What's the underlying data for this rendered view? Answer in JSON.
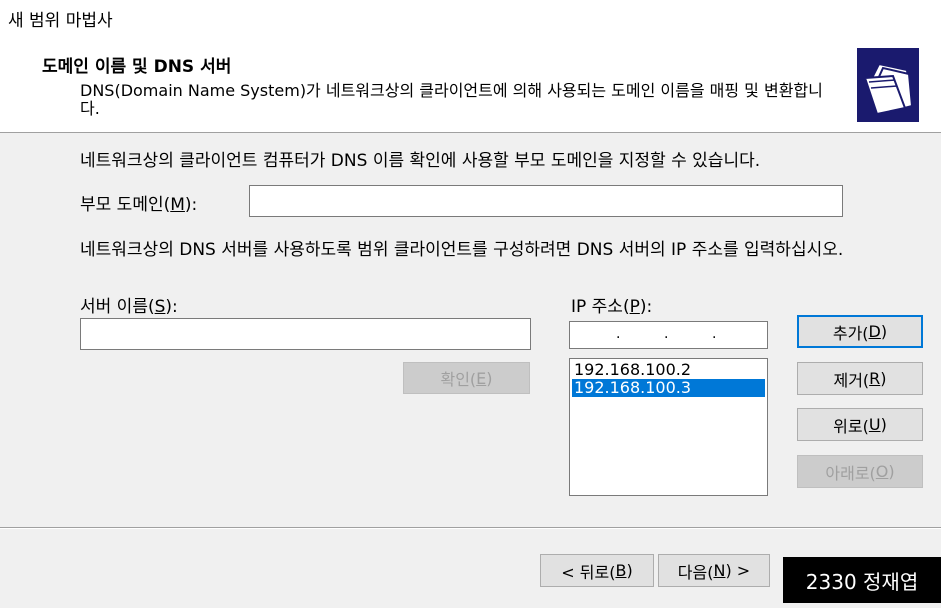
{
  "window": {
    "title": "새 범위 마법사"
  },
  "header": {
    "title": "도메인 이름 및 DNS 서버",
    "description": "DNS(Domain Name System)가 네트워크상의 클라이언트에 의해 사용되는 도메인 이름을 매핑 및 변환합니다.",
    "icon": "folders-icon"
  },
  "body": {
    "intro": "네트워크상의 클라이언트 컴퓨터가 DNS 이름 확인에 사용할 부모 도메인을 지정할 수 있습니다.",
    "parent_domain_label": "부모 도메인(",
    "parent_domain_key": "M",
    "parent_domain_suffix": "):",
    "parent_domain_value": "",
    "dns_instruction": "네트워크상의 DNS 서버를 사용하도록 범위 클라이언트를 구성하려면 DNS 서버의 IP 주소를 입력하십시오.",
    "server_name_label": "서버 이름(",
    "server_name_key": "S",
    "server_name_suffix": "):",
    "server_name_value": "",
    "ip_label": "IP 주소(",
    "ip_key": "P",
    "ip_suffix": "):",
    "resolve_button": {
      "label": "확인(",
      "key": "E",
      "suffix": ")"
    },
    "ip_list": [
      {
        "value": "192.168.100.2",
        "selected": false
      },
      {
        "value": "192.168.100.3",
        "selected": true
      }
    ],
    "buttons": {
      "add": {
        "label": "추가(",
        "key": "D",
        "suffix": ")"
      },
      "remove": {
        "label": "제거(",
        "key": "R",
        "suffix": ")"
      },
      "up": {
        "label": "위로(",
        "key": "U",
        "suffix": ")"
      },
      "down": {
        "label": "아래로(",
        "key": "O",
        "suffix": ")"
      }
    }
  },
  "footer": {
    "back": {
      "label": "< 뒤로(",
      "key": "B",
      "suffix": ")"
    },
    "next": {
      "label": "다음(",
      "key": "N",
      "suffix": ") >"
    }
  },
  "overlay": {
    "text": "2330 정재엽"
  },
  "colors": {
    "selection": "#0078d7",
    "logo_bg": "#1a1a6e"
  }
}
